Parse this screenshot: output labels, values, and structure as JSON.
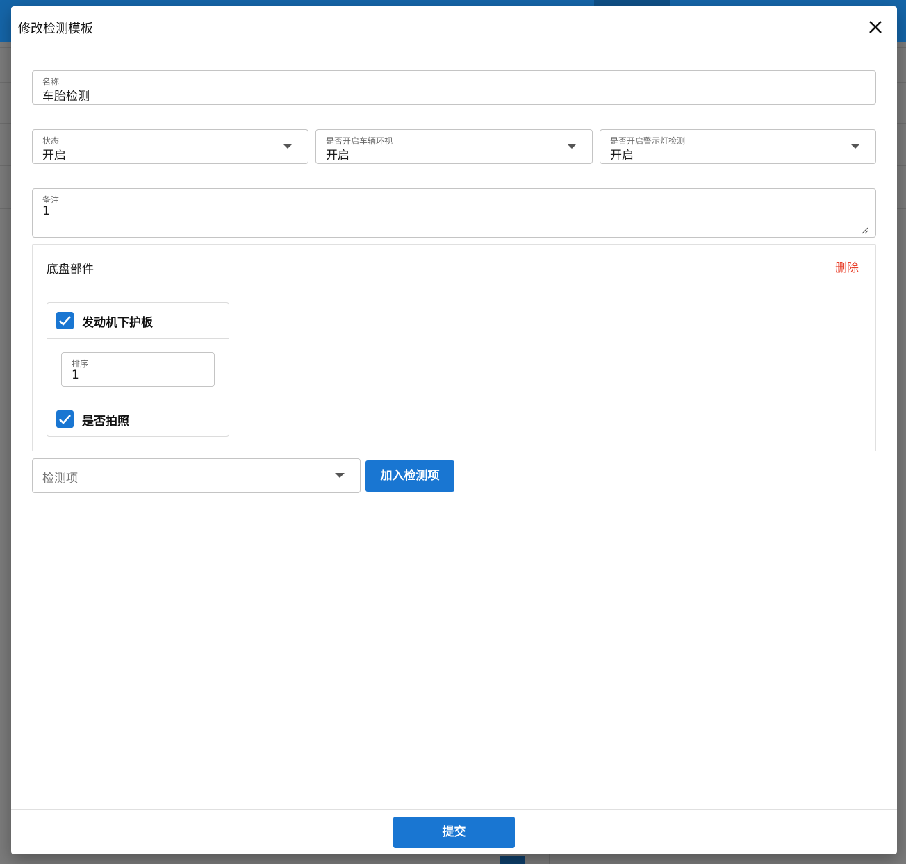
{
  "dialog": {
    "title": "修改检测模板",
    "close_icon": "close-icon"
  },
  "form": {
    "name": {
      "label": "名称",
      "value": "车胎检测"
    },
    "status": {
      "label": "状态",
      "value": "开启"
    },
    "surround_view": {
      "label": "是否开启车辆环视",
      "value": "开启"
    },
    "warning_light": {
      "label": "是否开启警示灯检测",
      "value": "开启"
    },
    "remark": {
      "label": "备注",
      "value": "1"
    }
  },
  "section": {
    "title": "底盘部件",
    "delete_label": "删除",
    "item": {
      "name": "发动机下护板",
      "checked": true,
      "order": {
        "label": "排序",
        "value": "1"
      },
      "photo": {
        "label": "是否拍照",
        "checked": true
      }
    }
  },
  "add": {
    "select_placeholder": "检测项",
    "button_label": "加入检测项"
  },
  "footer": {
    "submit_label": "提交"
  },
  "colors": {
    "primary": "#1976d2",
    "danger": "#e8412c"
  }
}
